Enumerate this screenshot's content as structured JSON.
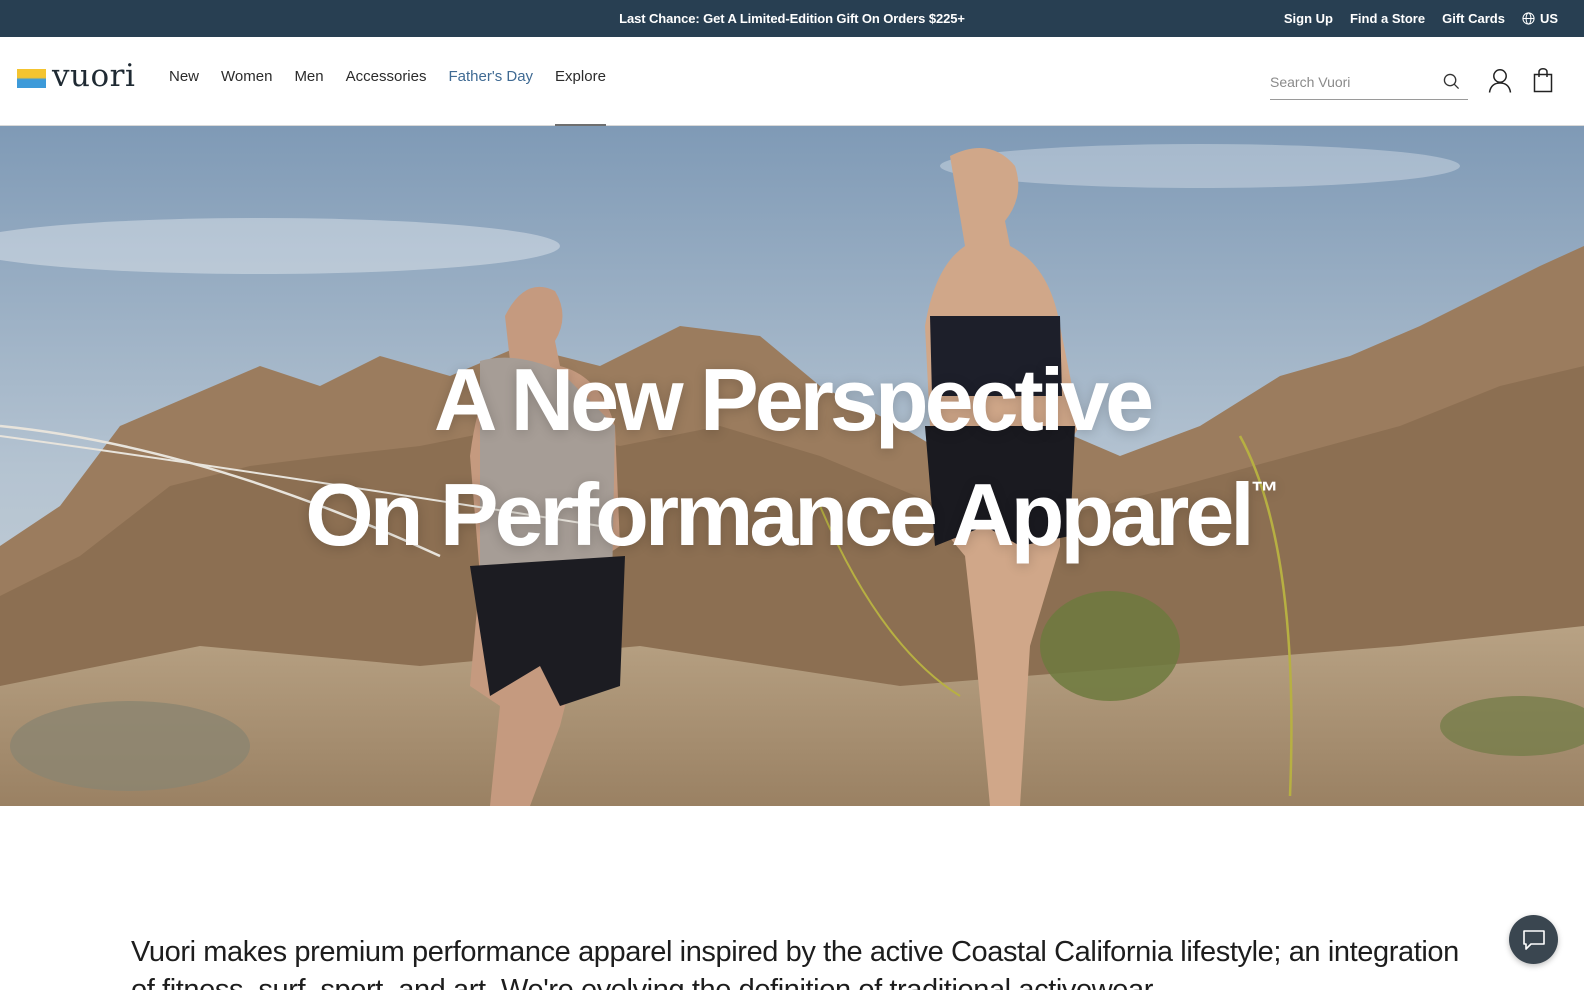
{
  "announcement": {
    "promo": "Last Chance: Get A Limited-Edition Gift On Orders $225+",
    "links": [
      "Sign Up",
      "Find a Store",
      "Gift Cards"
    ],
    "locale": "US",
    "background": "#283f52"
  },
  "header": {
    "logo_text": "vuori",
    "nav": [
      {
        "label": "New"
      },
      {
        "label": "Women"
      },
      {
        "label": "Men"
      },
      {
        "label": "Accessories"
      },
      {
        "label": "Father's Day",
        "highlight": true
      },
      {
        "label": "Explore",
        "active": true
      }
    ],
    "search": {
      "placeholder": "Search Vuori"
    },
    "icons": [
      "search-icon",
      "account-icon",
      "shopping-bag-icon"
    ],
    "accent_color": "#3f6a93"
  },
  "hero": {
    "headline_line1": "A New Perspective",
    "headline_line2": "On Performance Apparel",
    "trademark": "™"
  },
  "intro": {
    "text": "Vuori makes premium performance apparel inspired by the active Coastal California lifestyle; an integration of fitness, surf, sport, and art. We're evolving the definition of traditional activewear."
  },
  "chat": {
    "icon": "chat-bubble-icon"
  }
}
